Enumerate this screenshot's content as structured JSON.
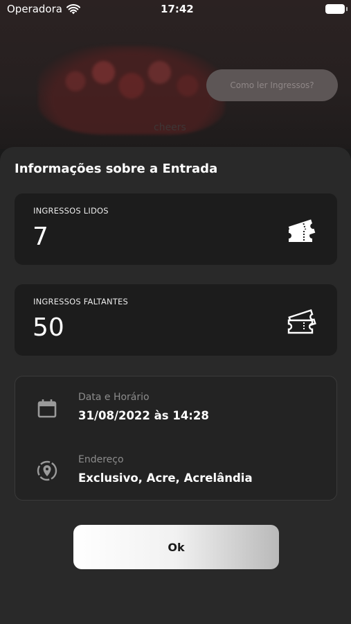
{
  "status_bar": {
    "carrier": "Operadora",
    "time": "17:42"
  },
  "hero": {
    "image_text": "cheers",
    "how_to_button": "Como ler Ingressos?"
  },
  "sheet": {
    "title": "Informações sobre a Entrada",
    "stats": [
      {
        "label": "INGRESSOS LIDOS",
        "value": "7",
        "icon": "ticket-icon"
      },
      {
        "label": "INGRESSOS FALTANTES",
        "value": "50",
        "icon": "ticket-outline-icon"
      }
    ],
    "info": {
      "date_label": "Data e Horário",
      "date_value": "31/08/2022 às 14:28",
      "address_label": "Endereço",
      "address_value": "Exclusivo, Acre, Acrelândia"
    },
    "ok_button": "Ok"
  },
  "colors": {
    "sheet_background": "#292929",
    "card_background": "#1c1c1c",
    "button_background": "#ffffff"
  }
}
